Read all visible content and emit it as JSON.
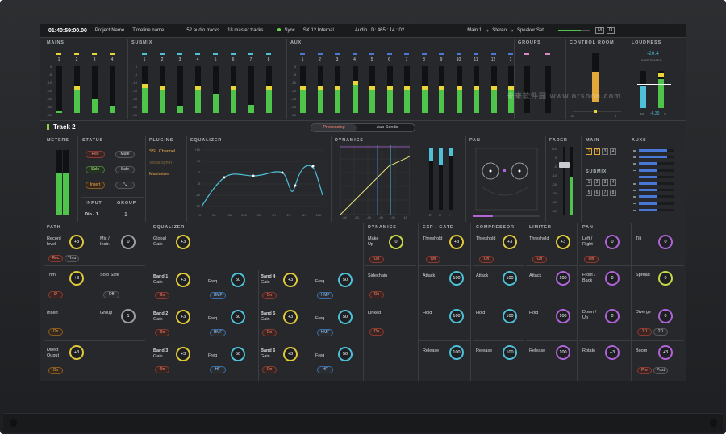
{
  "topbar": {
    "timecode": "01:40:59:00.00",
    "project": "Project Name",
    "timeline": "Timeline name",
    "audio_tracks": "52 audio tracks",
    "master_tracks": "18 master tracks",
    "sync": "Sync",
    "sync_source": "SX 12 Internal",
    "audio_pos": "Audio : D: 465 : 14 : 02",
    "out1": "Main 1",
    "out2": "Stereo",
    "out3": "Speaker Set",
    "btn_m": "M",
    "btn_d": "D"
  },
  "sections": {
    "mains": "MAINS",
    "submix": "SUBMIX",
    "aux": "AUX",
    "groups": "GROUPS",
    "control_room": "CONTROL ROOM",
    "loudness": "LOUDNESS"
  },
  "mains": {
    "labels": [
      "1",
      "2",
      "3",
      "4"
    ],
    "levels": [
      0.06,
      0.56,
      0.3,
      0.16
    ]
  },
  "submix": {
    "labels": [
      "1",
      "2",
      "3",
      "4",
      "5",
      "6",
      "7",
      "8"
    ],
    "levels": [
      0.62,
      0.56,
      0.14,
      0.56,
      0.4,
      0.56,
      0.18,
      0.56
    ]
  },
  "aux": {
    "labels": [
      "1",
      "2",
      "3",
      "4",
      "5",
      "6",
      "7",
      "8",
      "9",
      "10",
      "11",
      "12",
      "1"
    ],
    "levels": [
      0.56,
      0.56,
      0.56,
      0.68,
      0.56,
      0.56,
      0.56,
      0.56,
      0.56,
      0.56,
      0.56,
      0.56,
      0.56
    ]
  },
  "control_room": {
    "level": 0.62,
    "min": "-5",
    "max": "0"
  },
  "loudness": {
    "value": "-20.4",
    "label": "INTEGRATED",
    "m_label": "M",
    "m_value": "-6.30",
    "s_label": "S"
  },
  "scale": [
    "0",
    "-5",
    "-10",
    "-20",
    "-30",
    "-40",
    "-50"
  ],
  "track": {
    "name": "Track 2",
    "tab_processing": "Processing",
    "tab_aux": "Aux Sends"
  },
  "row2": {
    "meters": "METERS",
    "status": "STATUS",
    "plugins": "PLUGINS",
    "equalizer": "EQUALIZER",
    "dynamics": "DYNAMICS",
    "pan": "PAN",
    "fader": "FADER",
    "main": "MAIN",
    "auxs": "AUXS",
    "submix": "SUBMIX"
  },
  "status": {
    "rec": "Rec",
    "mute": "Mute",
    "solo": "Solo",
    "safe": "Safe",
    "insert": "Insert",
    "input_label": "INPUT",
    "group_label": "GROUP",
    "input_value": "Dio - 1",
    "group_value": "1"
  },
  "plugins": [
    "SSL Channel",
    "Vocal synth",
    "Maximizer"
  ],
  "eq_x": [
    "1K",
    "20",
    "100",
    "200",
    "500",
    "1K",
    "2K",
    "5K",
    "10K"
  ],
  "eq_y": [
    "+10",
    "+5",
    "0",
    "-5",
    "-10",
    "-15"
  ],
  "dyn_x": [
    "-60",
    "-50",
    "-40",
    "-30",
    "-20",
    "-10"
  ],
  "dyn_meter_labels": [
    "E",
    "C",
    "L"
  ],
  "main_buttons": [
    "1",
    "2",
    "3",
    "4"
  ],
  "submix_buttons": [
    "1",
    "2",
    "3",
    "4",
    "5",
    "6",
    "7",
    "8"
  ],
  "fader_scale": [
    "+10",
    "0",
    "-5",
    "-10",
    "-20",
    "-30",
    "-40",
    "-50"
  ],
  "bottom": {
    "path": "PATH",
    "equalizer": "EQUALIZER",
    "dynamics": "DYNAMICS",
    "exp_gate": "EXP / GATE",
    "compressor": "COMPRESSOR",
    "limiter": "LIMITER",
    "pan": "PAN",
    "record_level": "Record level",
    "record_val": "+3",
    "mic_instr": "Mic / Instr.",
    "mic_val": "0",
    "rec": "Rec",
    "thru": "Thru",
    "trim": "Trim",
    "trim_val": "+3",
    "solo_safe": "Solo Safe",
    "off": "Off",
    "phase": "Ø",
    "insert": "Insert",
    "on": "On",
    "group": "Group",
    "group_val": "1",
    "direct_output": "Direct Ouput",
    "direct_val": "+3",
    "global_gain": "Global Gain",
    "global_val": "+3",
    "bands": [
      {
        "name": "Band 1",
        "gain": "+3",
        "freq": "50",
        "type": "HMF"
      },
      {
        "name": "Band 2",
        "gain": "+3",
        "freq": "50",
        "type": "HMF"
      },
      {
        "name": "Band 3",
        "gain": "+3",
        "freq": "50",
        "type": "HF"
      },
      {
        "name": "Band 4",
        "gain": "+3",
        "freq": "50",
        "type": "HMF"
      },
      {
        "name": "Band 5",
        "gain": "+3",
        "freq": "50",
        "type": "HMF"
      },
      {
        "name": "Band 6",
        "gain": "+3",
        "freq": "50",
        "type": "HF"
      }
    ],
    "gain": "Gain",
    "freq": "Freq",
    "hz": "Hz",
    "make_up": "Make Up",
    "make_up_val": "0",
    "sidechain": "Sidechain",
    "linked": "Linked",
    "threshold": "Threshold",
    "thr_val": "+3",
    "attack": "Attack",
    "hold": "Hold",
    "release": "Release",
    "time_val": "100",
    "left_right": "Left / Right",
    "front_back": "Front / Back",
    "down_up": "Down / Up",
    "rotate": "Rotate",
    "rotate_val": "+3",
    "tilt": "Tilt",
    "spread": "Spread",
    "diverge": "Diverge",
    "boom": "Boom",
    "boom_val": "+3",
    "pan_val": "0",
    "mode_1d": "1D",
    "mode_2d": "2D",
    "pre": "Pre",
    "post": "Post"
  },
  "watermark": "未来软件园 www.orsoon.com"
}
